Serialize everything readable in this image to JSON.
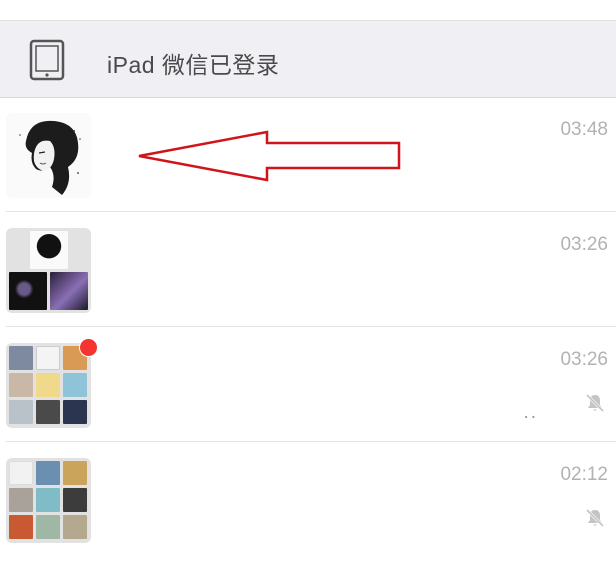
{
  "ipad_banner": {
    "text": "iPad 微信已登录",
    "icon": "ipad-icon"
  },
  "chats": [
    {
      "time": "03:48",
      "preview": "",
      "muted": false,
      "unread_dot": false,
      "avatar": "single-portrait"
    },
    {
      "time": "03:26",
      "preview": "",
      "muted": false,
      "unread_dot": false,
      "avatar": "group-3"
    },
    {
      "time": "03:26",
      "preview": "..",
      "muted": true,
      "unread_dot": true,
      "avatar": "group-9"
    },
    {
      "time": "02:12",
      "preview": "",
      "muted": true,
      "unread_dot": false,
      "avatar": "group-9"
    }
  ],
  "annotation": {
    "arrow_color": "#d0141c",
    "points_to": "chat-row-1-avatar"
  },
  "colors": {
    "banner_bg": "#efeff4",
    "time_text": "#b2b2b2",
    "badge": "#f43530"
  }
}
